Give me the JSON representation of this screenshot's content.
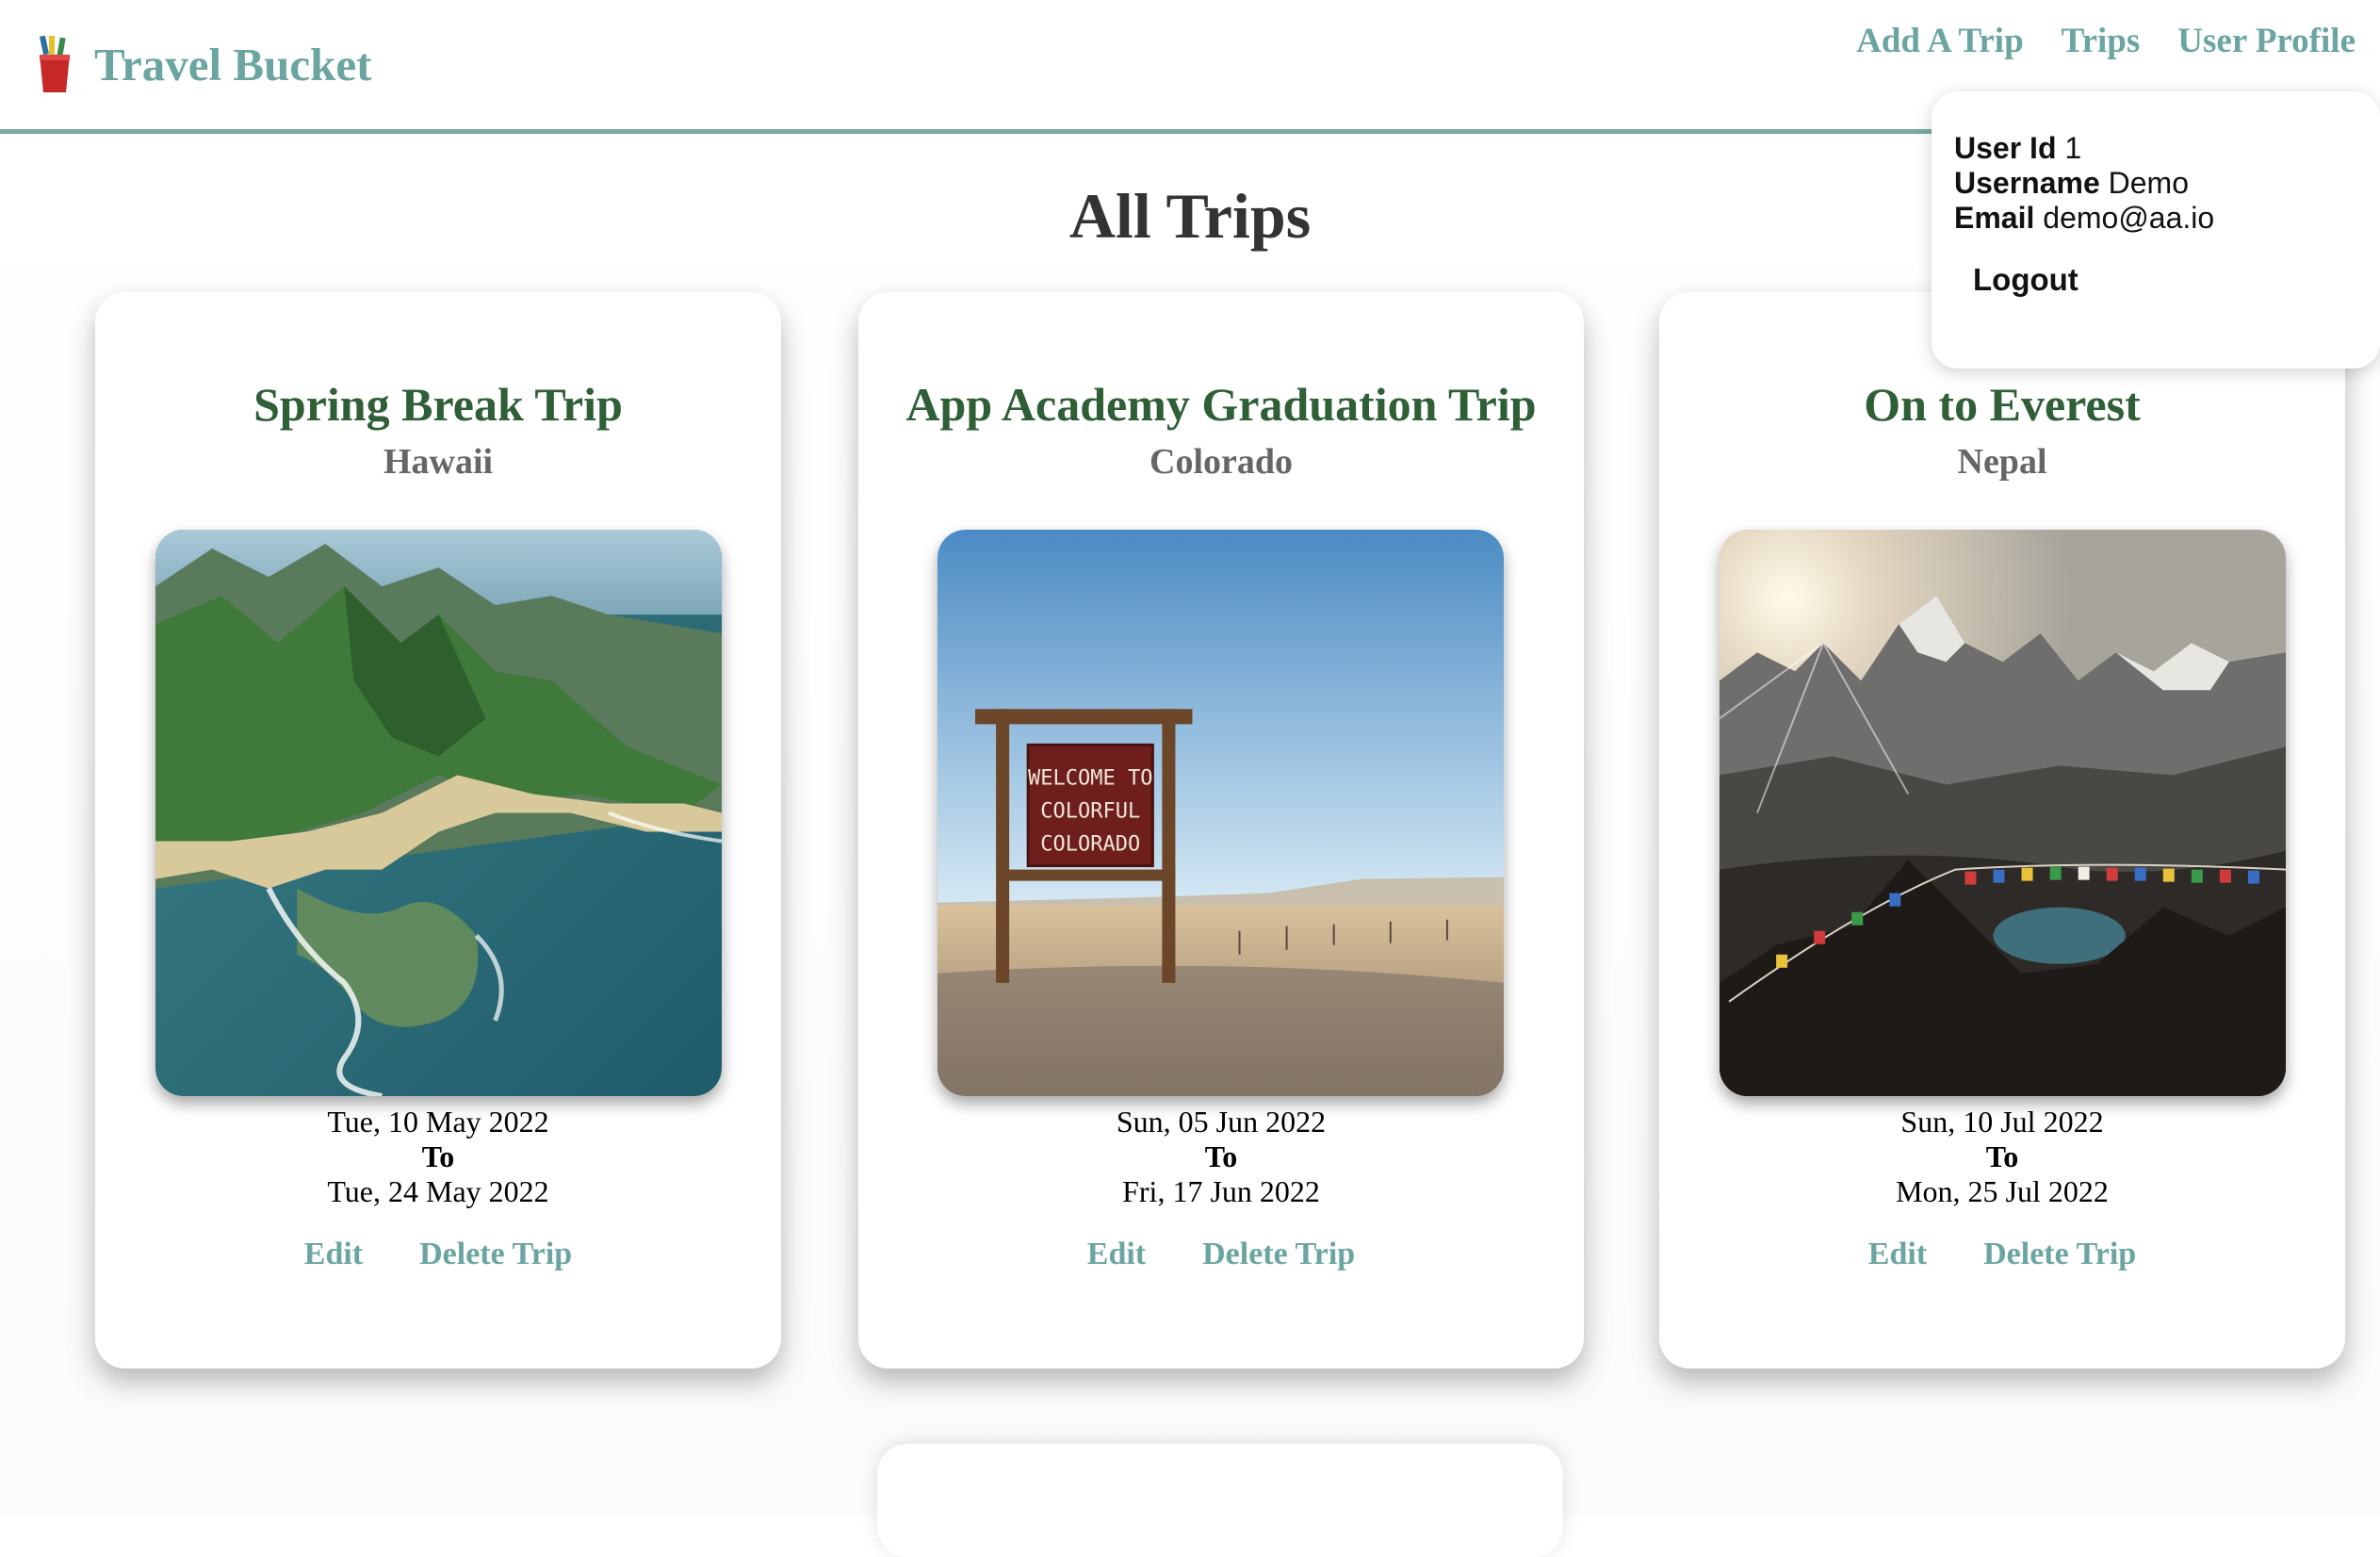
{
  "header": {
    "brand": "Travel Bucket",
    "nav": [
      "Add A Trip",
      "Trips",
      "User Profile"
    ]
  },
  "profile": {
    "user_id_label": "User Id",
    "user_id": "1",
    "username_label": "Username",
    "username": "Demo",
    "email_label": "Email",
    "email": "demo@aa.io",
    "logout": "Logout"
  },
  "page": {
    "title": "All Trips"
  },
  "trips": [
    {
      "name": "Spring Break Trip",
      "location": "Hawaii",
      "start": "Tue, 10 May 2022",
      "to": "To",
      "end": "Tue, 24 May 2022",
      "edit": "Edit",
      "delete": "Delete Trip"
    },
    {
      "name": "App Academy Graduation Trip",
      "location": "Colorado",
      "start": "Sun, 05 Jun 2022",
      "to": "To",
      "end": "Fri, 17 Jun 2022",
      "edit": "Edit",
      "delete": "Delete Trip",
      "sign_text": [
        "WELCOME TO",
        "COLORFUL",
        "COLORADO"
      ]
    },
    {
      "name": "On to Everest",
      "location": "Nepal",
      "start": "Sun, 10 Jul 2022",
      "to": "To",
      "end": "Mon, 25 Jul 2022",
      "edit": "Edit",
      "delete": "Delete Trip"
    }
  ],
  "colors": {
    "accent": "#6aa5a0",
    "trip_title": "#2e5f36",
    "location": "#666666"
  }
}
